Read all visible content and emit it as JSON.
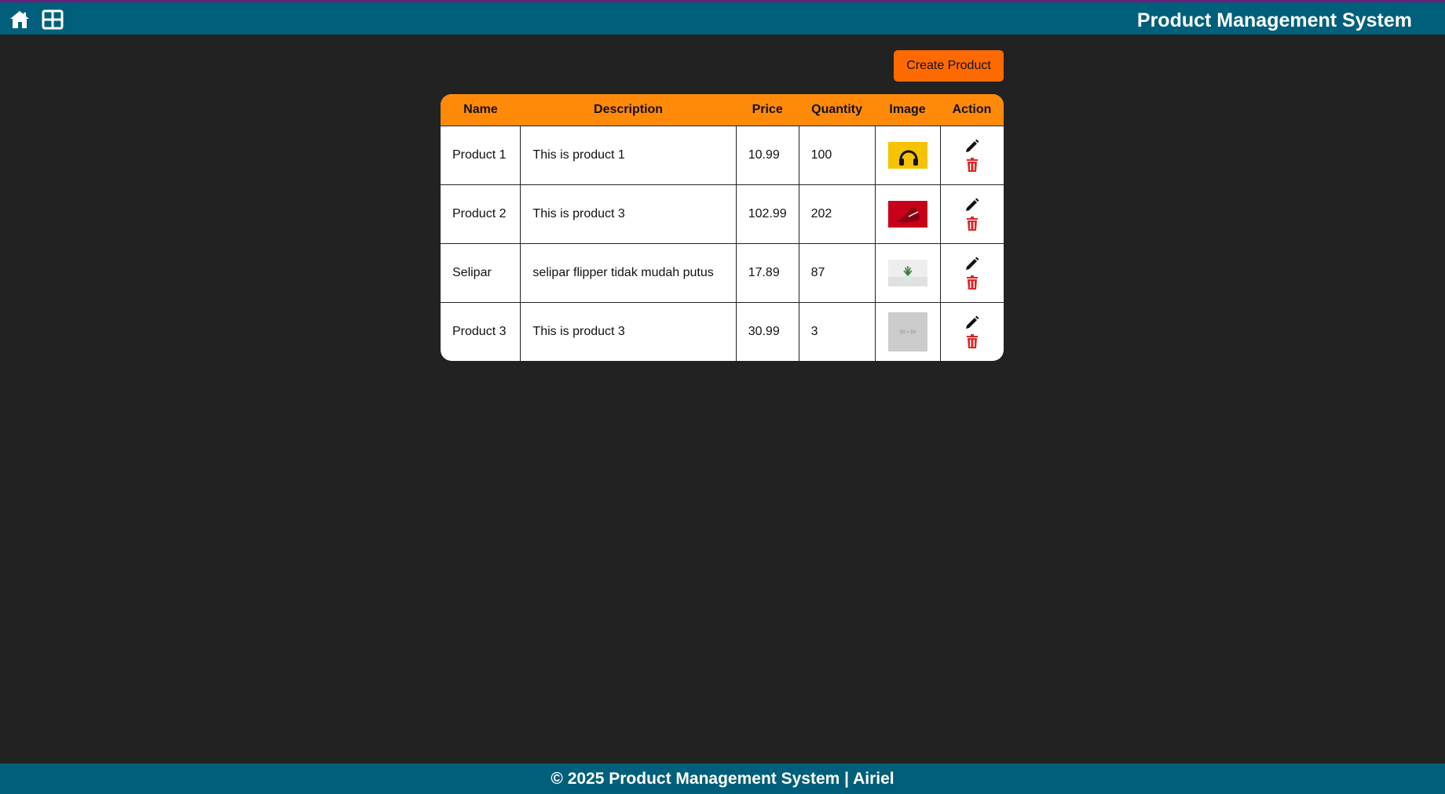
{
  "header": {
    "home_icon": "home-icon",
    "grid_icon": "grid-icon",
    "title": "Product Management System",
    "bg_color": "#005f7a"
  },
  "toolbar": {
    "create_label": "Create Product",
    "accent_color": "#ff6a00"
  },
  "table": {
    "columns": [
      "Name",
      "Description",
      "Price",
      "Quantity",
      "Image",
      "Action"
    ],
    "rows": [
      {
        "name": "Product 1",
        "description": "This is product 1",
        "price": "10.99",
        "quantity": "100",
        "image": "headphones-thumbnail"
      },
      {
        "name": "Product 2",
        "description": "This is product 3",
        "price": "102.99",
        "quantity": "202",
        "image": "red-shoe-thumbnail"
      },
      {
        "name": "Selipar",
        "description": "selipar flipper tidak mudah putus",
        "price": "17.89",
        "quantity": "87",
        "image": "plant-thumbnail"
      },
      {
        "name": "Product 3",
        "description": "This is product 3",
        "price": "30.99",
        "quantity": "3",
        "image": "placeholder-thumbnail",
        "placeholder_text": "50 × 50"
      }
    ],
    "actions": {
      "edit_icon": "pencil-icon",
      "delete_icon": "trash-icon",
      "delete_color": "#e02424"
    }
  },
  "footer": {
    "text": "© 2025 Product Management System | Airiel"
  }
}
